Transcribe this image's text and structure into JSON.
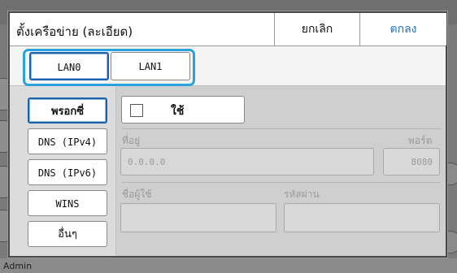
{
  "dialog": {
    "title": "ตั้งเครือข่าย (ละเอียด)",
    "cancel_label": "ยกเลิก",
    "ok_label": "ตกลง"
  },
  "lan_tabs": [
    {
      "label": "LAN0",
      "selected": true
    },
    {
      "label": "LAN1",
      "selected": false
    }
  ],
  "sidebar": {
    "items": [
      {
        "label": "พรอกซี่",
        "selected": true
      },
      {
        "label": "DNS (IPv4)",
        "selected": false
      },
      {
        "label": "DNS (IPv6)",
        "selected": false
      },
      {
        "label": "WINS",
        "selected": false
      },
      {
        "label": "อื่นๆ",
        "selected": false
      }
    ]
  },
  "proxy": {
    "use_label": "ใช้",
    "use_checked": false,
    "address_label": "ที่อยู่",
    "address_value": "0.0.0.0",
    "port_label": "พอร์ต",
    "port_value": "8080",
    "username_label": "ชื่อผู้ใช้",
    "username_value": "",
    "password_label": "รหัสผ่าน",
    "password_value": ""
  },
  "background": {
    "bottom_text": "Admin"
  },
  "colors": {
    "accent": "#1d70c8",
    "highlight": "#29a3dd",
    "disabled_text": "#9a9a9a"
  }
}
